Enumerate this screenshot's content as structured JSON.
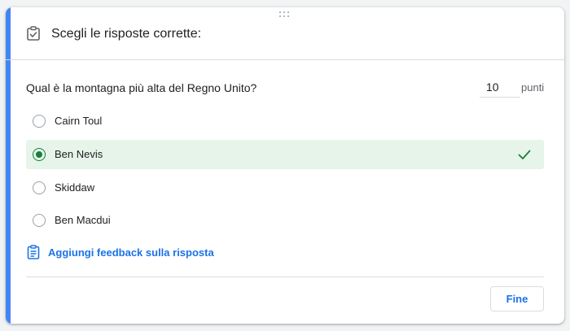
{
  "header": {
    "title": "Scegli le risposte corrette:",
    "icon": "checklist-clipboard-icon"
  },
  "question": {
    "text": "Qual è la montagna più alta del Regno Unito?",
    "points_value": "10",
    "points_label": "punti"
  },
  "options": [
    {
      "label": "Cairn Toul",
      "selected": false
    },
    {
      "label": "Ben Nevis",
      "selected": true,
      "correct": true
    },
    {
      "label": "Skiddaw",
      "selected": false
    },
    {
      "label": "Ben Macdui",
      "selected": false
    }
  ],
  "feedback": {
    "label": "Aggiungi feedback sulla risposta",
    "icon": "feedback-clipboard-icon"
  },
  "footer": {
    "done_label": "Fine"
  },
  "colors": {
    "accent": "#4285f4",
    "correct_bg": "#e6f4ea",
    "correct_green": "#188038",
    "link_blue": "#1a73e8"
  }
}
